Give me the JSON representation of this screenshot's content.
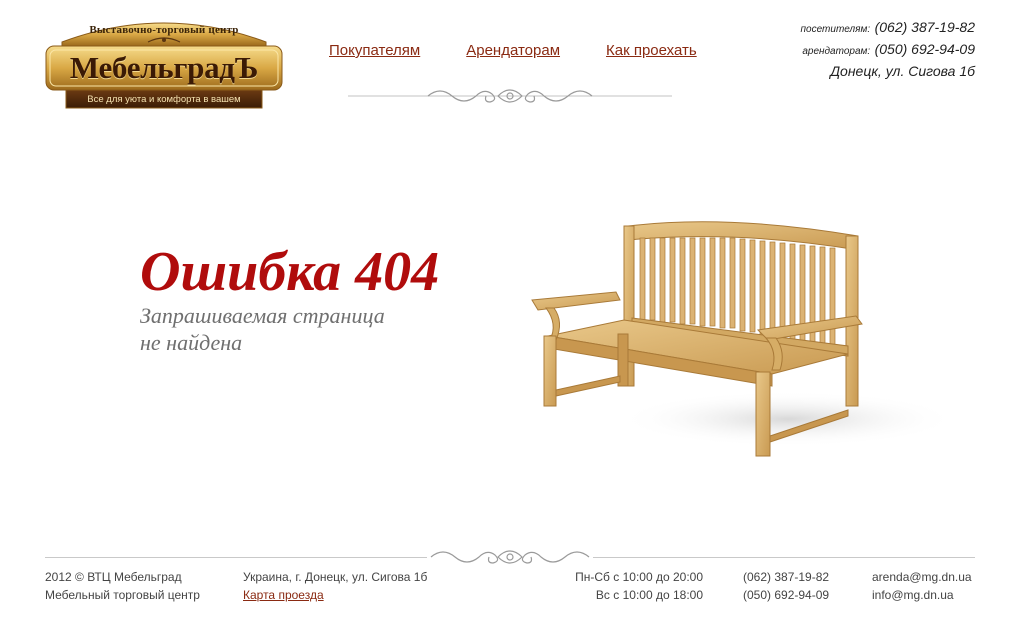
{
  "logo": {
    "top_text": "Выставочно-торговый центр",
    "name": "МебельградЪ",
    "tagline": "Все для уюта и комфорта в вашем"
  },
  "nav": {
    "items": [
      "Покупателям",
      "Арендаторам",
      "Как проехать"
    ]
  },
  "contacts": {
    "visitors_label": "посетителям:",
    "visitors_phone": "(062) 387-19-82",
    "tenants_label": "арендаторам:",
    "tenants_phone": "(050) 692-94-09",
    "address": "Донецк, ул. Сигова 1б"
  },
  "error": {
    "title": "Ошибка 404",
    "subtitle_line1": "Запрашиваемая страница",
    "subtitle_line2": "не найдена"
  },
  "footer": {
    "copyright": "2012 © ВТЦ Мебельград",
    "company": "Мебельный торговый центр",
    "address": "Украина, г. Донецк, ул. Сигова 1б",
    "map_link": "Карта проезда",
    "hours_weekday": "Пн-Сб с 10:00 до 20:00",
    "hours_sunday": "Вс с 10:00 до 18:00",
    "phone1": "(062) 387-19-82",
    "phone2": "(050) 692-94-09",
    "email1": "arenda@mg.dn.ua",
    "email2": "info@mg.dn.ua"
  },
  "colors": {
    "accent_red": "#b00c0c",
    "link": "#8a2a12",
    "logo_gold": "#d9a845"
  }
}
